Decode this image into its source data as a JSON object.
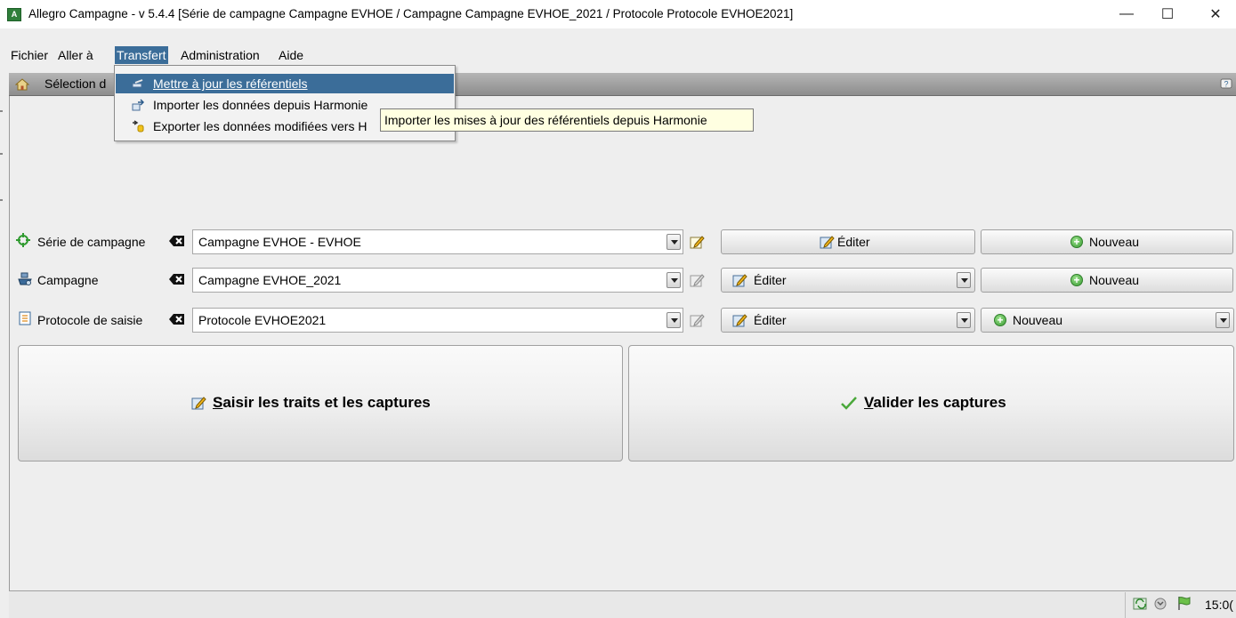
{
  "window": {
    "title": "Allegro Campagne - v 5.4.4 [Série de campagne Campagne EVHOE / Campagne Campagne EVHOE_2021 / Protocole Protocole EVHOE2021]",
    "minimize": "—",
    "maximize": "☐",
    "close": "✕"
  },
  "menubar": {
    "items": [
      {
        "label": "Fichier"
      },
      {
        "label": "Aller à"
      },
      {
        "label": "Transfert"
      },
      {
        "label": "Administration"
      },
      {
        "label": "Aide"
      }
    ]
  },
  "nav": {
    "label": "Sélection d"
  },
  "transfert_menu": {
    "items": [
      {
        "label": "Mettre à jour les référentiels",
        "icon": "update-referential-icon"
      },
      {
        "label": "Importer les données depuis Harmonie",
        "icon": "import-icon"
      },
      {
        "label": "Exporter les données modifiées vers H",
        "icon": "export-icon"
      }
    ]
  },
  "tooltip": {
    "text": "Importer les mises à jour des référentiels depuis Harmonie"
  },
  "form": {
    "serie": {
      "label": "Série de campagne",
      "value": "Campagne EVHOE - EVHOE",
      "edit_label": "Éditer",
      "new_label": "Nouveau"
    },
    "campagne": {
      "label": "Campagne",
      "value": "Campagne EVHOE_2021",
      "edit_label": "Éditer",
      "new_label": "Nouveau"
    },
    "protocole": {
      "label": "Protocole de saisie",
      "value": "Protocole EVHOE2021",
      "edit_label": "Éditer",
      "new_label": "Nouveau"
    }
  },
  "actions": {
    "saisir_first": "S",
    "saisir_rest": "aisir les traits et les captures",
    "valider_first": "V",
    "valider_rest": "alider les captures"
  },
  "status": {
    "clock": "15:0("
  },
  "colors": {
    "menu_highlight": "#3b6d99",
    "tooltip_bg": "#ffffe1",
    "accent_green": "#3a9a33"
  }
}
